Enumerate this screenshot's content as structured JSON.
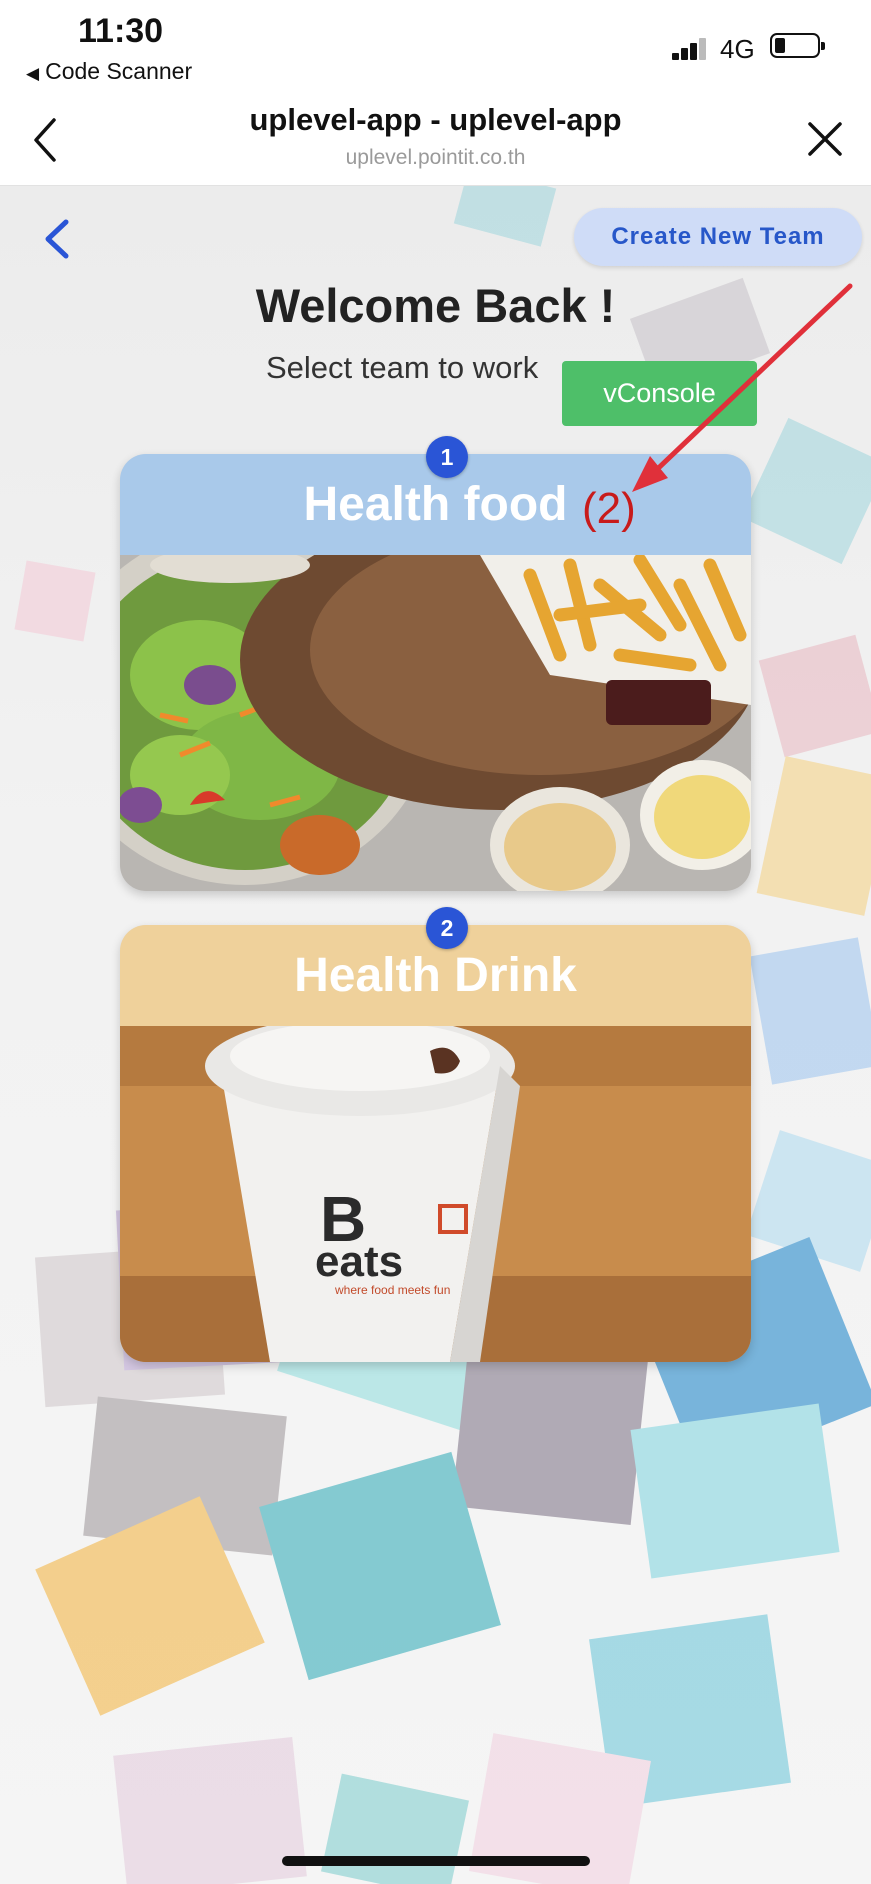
{
  "status_bar": {
    "time": "11:30",
    "back_app_label": "Code Scanner",
    "network": "4G"
  },
  "webview": {
    "title": "uplevel-app - uplevel-app",
    "url": "uplevel.pointit.co.th"
  },
  "page": {
    "create_team_label": "Create New Team",
    "welcome": "Welcome Back !",
    "subtitle": "Select team to work",
    "vconsole_label": "vConsole"
  },
  "teams": [
    {
      "index": "1",
      "name": "Health food",
      "head_color": "#a9c9ea",
      "image": "salad-and-fries-photo"
    },
    {
      "index": "2",
      "name": "Health Drink",
      "head_color": "#efd19b",
      "image": "eats-coffee-cup-photo"
    }
  ],
  "annotation": {
    "text": "(2)",
    "color": "#e0303a"
  },
  "colors": {
    "accent_blue": "#2a55d6",
    "vconsole_green": "#4ebf69"
  }
}
